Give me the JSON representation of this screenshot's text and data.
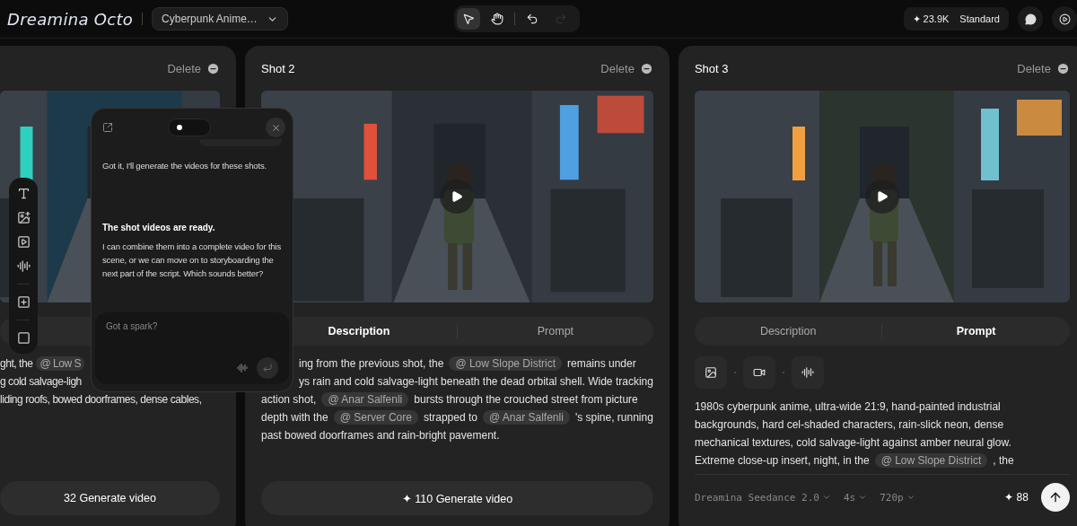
{
  "header": {
    "logo": "Dreamina Octo",
    "project": "Cyberpunk Anime…",
    "tools": [
      {
        "kind": "select",
        "selected": true
      },
      {
        "kind": "hand",
        "selected": false
      },
      {
        "kind": "undo",
        "disabled": false
      },
      {
        "kind": "redo",
        "disabled": true
      }
    ],
    "credits": "✦ 23.9K",
    "plan": "Standard"
  },
  "shots": [
    {
      "kind": "description",
      "delete_label": "Delete",
      "play_button": false,
      "lines": [
        {
          "parts": [
            {
              "text": "ght, the"
            },
            {
              "chip": "@ Low S"
            }
          ]
        },
        {
          "parts": [
            {
              "text": "g cold salvage-ligh"
            }
          ]
        },
        {
          "parts": [
            {
              "text": "liding roofs, bowed doorframes, dense cables,"
            }
          ]
        }
      ],
      "button": "32 Generate video"
    },
    {
      "kind": "description",
      "title": "Shot 2",
      "delete_label": "Delete",
      "play_button": true,
      "tabs": [
        {
          "label": "Description",
          "selected": true
        },
        {
          "label": "Prompt",
          "selected": false
        }
      ],
      "lines": [
        {
          "covered": true,
          "parts": [
            {
              "text": "ing from the previous shot, the"
            },
            {
              "chip": "@ Low Slope District"
            },
            {
              "text": "remains under"
            }
          ]
        },
        {
          "covered": true,
          "parts": [
            {
              "text": "ys rain and cold salvage-light beneath the dead orbital shell. Wide tracking"
            }
          ]
        },
        {
          "parts": [
            {
              "text": "action shot,"
            },
            {
              "chip": "@ Anar Salfenli"
            },
            {
              "text": "bursts through the crouched street from picture"
            }
          ]
        },
        {
          "parts": [
            {
              "text": "depth with the"
            },
            {
              "chip": "@ Server Core"
            },
            {
              "text": "strapped to"
            },
            {
              "chip": "@ Anar Salfenli"
            },
            {
              "text": "'s spine, running"
            }
          ]
        },
        {
          "parts": [
            {
              "text": "past bowed doorframes and rain-bright pavement."
            }
          ]
        }
      ],
      "button": "✦ 110 Generate video"
    },
    {
      "kind": "prompt",
      "title": "Shot 3",
      "delete_label": "Delete",
      "play_button": true,
      "tabs": [
        {
          "label": "Description",
          "selected": false
        },
        {
          "label": "Prompt",
          "selected": true
        }
      ],
      "lines": [
        {
          "parts": [
            {
              "text": "1980s cyberpunk anime, ultra-wide 21:9, hand-painted industrial"
            }
          ]
        },
        {
          "parts": [
            {
              "text": "backgrounds, hard cel-shaded characters, rain-slick neon, dense"
            }
          ]
        },
        {
          "parts": [
            {
              "text": "mechanical textures, cold salvage-light against amber neural glow."
            }
          ]
        },
        {
          "parts": [
            {
              "text": "Extreme close-up insert, night, in the"
            },
            {
              "chip": "@ Low Slope District"
            },
            {
              "text": ", the"
            }
          ]
        }
      ],
      "options": [
        "Dreamina Seedance 2.0",
        "4s",
        "720p"
      ],
      "cost": "✦ 88"
    }
  ],
  "chat": {
    "messages": [
      {
        "text": "Got it, I'll generate the videos for these shots."
      },
      {
        "title": "The shot videos are ready.",
        "text": "I can combine them into a complete video for this scene, or we can move on to storyboarding the next part of the script. Which sounds better?"
      }
    ],
    "placeholder": "Got a spark?"
  }
}
